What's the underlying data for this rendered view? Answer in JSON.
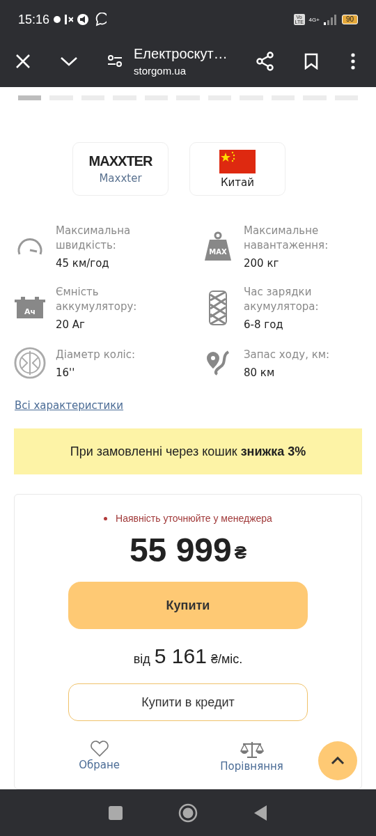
{
  "status_bar": {
    "time": "15:16",
    "network": "4G+",
    "volte": "Vo LTE",
    "battery": "90"
  },
  "toolbar": {
    "title": "Електроскут…",
    "url": "storgom.ua"
  },
  "gallery_indicators": [
    {
      "selected": true
    },
    {
      "selected": false
    },
    {
      "selected": false
    },
    {
      "selected": false
    },
    {
      "selected": false
    },
    {
      "selected": false
    },
    {
      "selected": false
    },
    {
      "selected": false
    },
    {
      "selected": false
    },
    {
      "selected": false
    },
    {
      "selected": false
    }
  ],
  "badges": [
    {
      "kind": "brand",
      "logo": "MAXXTER",
      "label": "Maxxter"
    },
    {
      "kind": "country",
      "label": "Китай"
    }
  ],
  "specs": [
    {
      "kind": "speed",
      "label": "Максимальна швидкість:",
      "value": "45 км/год"
    },
    {
      "kind": "weight",
      "label": "Максимальне навантаження:",
      "value": "200 кг"
    },
    {
      "kind": "battery",
      "icon_text": "Ач",
      "label": "Ємність аккумулятору:",
      "value": "20 Аг"
    },
    {
      "kind": "charge",
      "label": "Час зарядки акумулятора:",
      "value": "6-8 год"
    },
    {
      "kind": "wheel",
      "label": "Діаметр коліс:",
      "value": "16''"
    },
    {
      "kind": "range",
      "label": "Запас ходу, км:",
      "value": "80 км"
    }
  ],
  "weight_icon_text": "MAX",
  "all_specs_link": "Всі характеристики",
  "promo": "При замовленні через кошик **знижка 3%**",
  "buy_box": {
    "availability": "Наявність уточнюйте у менеджера",
    "price": "55 999",
    "currency": "₴",
    "buy_button": "Купити",
    "installment_prefix": "від",
    "installment_amount": "5 161",
    "installment_suffix": "₴/міс.",
    "credit_button": "Купити в кредит",
    "actions": [
      {
        "kind": "favorite",
        "label": "Обране"
      },
      {
        "kind": "compare",
        "label": "Порівняння"
      }
    ]
  }
}
